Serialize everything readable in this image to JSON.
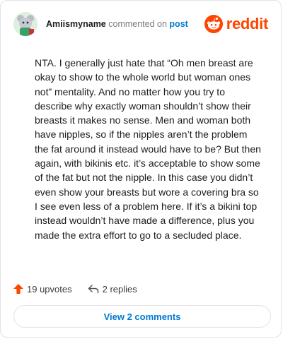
{
  "comment": {
    "username": "Amiismyname",
    "action": "commented on",
    "target": "post",
    "text": "NTA. I generally just hate that “Oh men breast are okay to show to the whole world but woman ones not” mentality. And no matter how you try to describe why exactly woman shouldn’t show their breasts it makes no sense. Men and woman both have nipples, so if the nipples aren’t the problem the fat around it instead would have to be? But then again, with bikinis etc. it’s acceptable to show some of the fat but not the nipple. In this case you didn’t even show your breasts but wore a covering bra so I see even less of a problem here. If it’s a bikini top instead wouldn’t have made a difference, plus you made the extra effort to go to a secluded place.",
    "upvotes": "19 upvotes",
    "replies": "2 replies"
  },
  "brand": {
    "name": "reddit",
    "color": "#ff4500"
  },
  "actions": {
    "view_comments": "View 2 comments"
  },
  "colors": {
    "link": "#0079d3",
    "upvote": "#ff4500",
    "text": "#1c1c1c",
    "muted": "#7c7c7c"
  }
}
